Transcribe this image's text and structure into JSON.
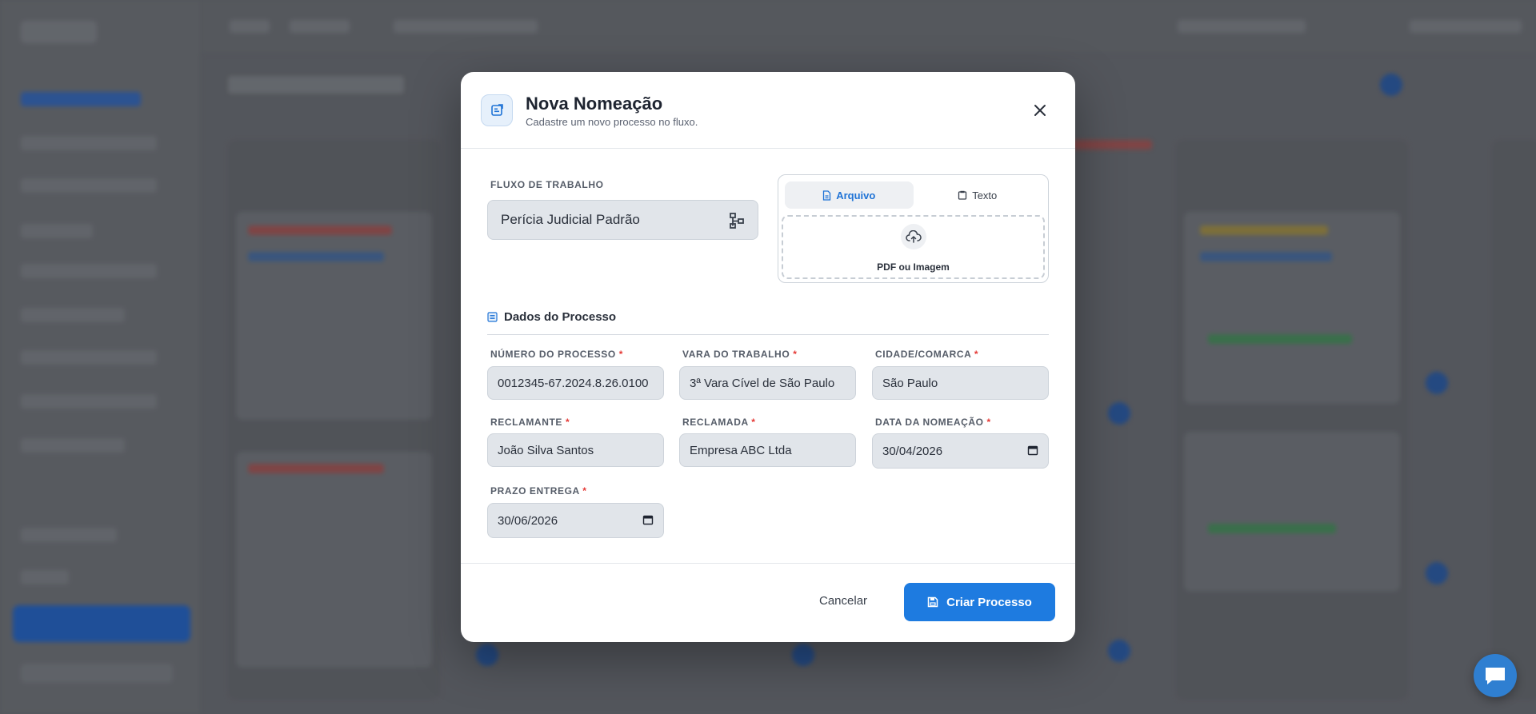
{
  "modal": {
    "title": "Nova Nomeação",
    "subtitle": "Cadastre um novo processo no fluxo."
  },
  "workflow": {
    "label": "FLUXO DE TRABALHO",
    "value": "Perícia Judicial Padrão"
  },
  "upload": {
    "tabs": [
      {
        "label": "Arquivo",
        "active": true
      },
      {
        "label": "Texto",
        "active": false
      }
    ],
    "dropzone_text": "PDF ou Imagem"
  },
  "section": {
    "title": "Dados do Processo"
  },
  "fields": {
    "numero": {
      "label": "NÚMERO DO PROCESSO",
      "value": "0012345-67.2024.8.26.0100"
    },
    "vara": {
      "label": "VARA DO TRABALHO",
      "value": "3ª Vara Cível de São Paulo"
    },
    "cidade": {
      "label": "CIDADE/COMARCA",
      "value": "São Paulo"
    },
    "reclamante": {
      "label": "RECLAMANTE",
      "value": "João Silva Santos"
    },
    "reclamada": {
      "label": "RECLAMADA",
      "value": "Empresa ABC Ltda"
    },
    "data_nomeacao": {
      "label": "DATA DA NOMEAÇÃO",
      "value": "30/04/2026"
    },
    "prazo": {
      "label": "PRAZO ENTREGA",
      "value": "30/06/2026"
    },
    "required_mark": "*"
  },
  "footer": {
    "cancel_label": "Cancelar",
    "create_label": "Criar Processo"
  },
  "colors": {
    "primary": "#1e7be0",
    "required": "#e53935"
  }
}
